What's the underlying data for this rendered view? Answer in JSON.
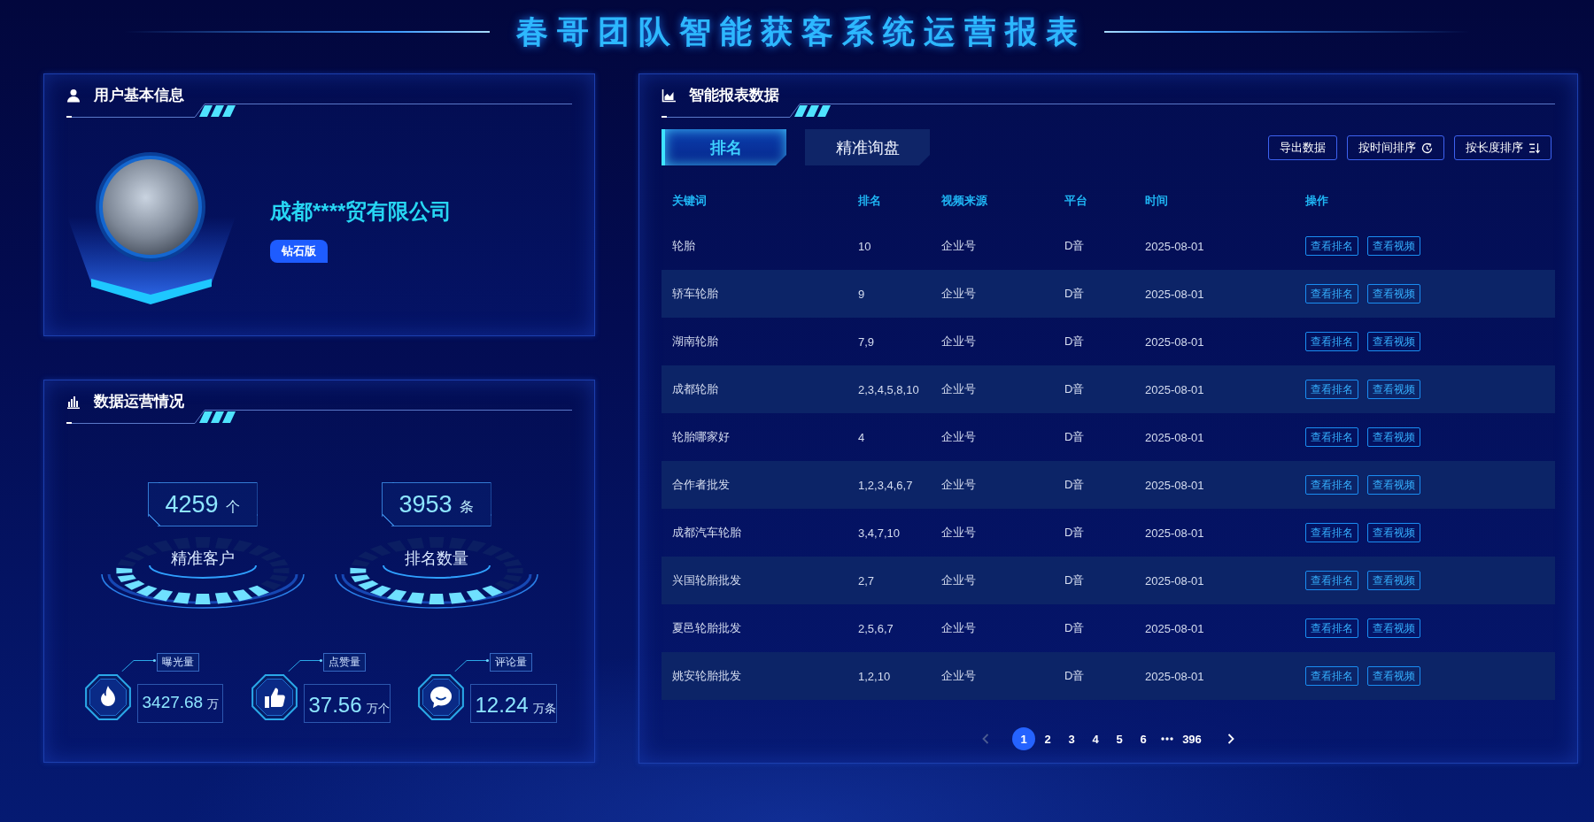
{
  "title": "春哥团队智能获客系统运营报表",
  "user_panel": {
    "title": "用户基本信息",
    "company": "成都****贸有限公司",
    "badge": "钻石版"
  },
  "operations_panel": {
    "title": "数据运营情况",
    "stats": [
      {
        "value": "4259",
        "unit": "个",
        "label": "精准客户"
      },
      {
        "value": "3953",
        "unit": "条",
        "label": "排名数量"
      }
    ],
    "metrics": [
      {
        "kind": "views",
        "label": "曝光量",
        "value": "3427.68",
        "unit": "万"
      },
      {
        "kind": "likes",
        "label": "点赞量",
        "value": "37.56",
        "unit": "万个"
      },
      {
        "kind": "comments",
        "label": "评论量",
        "value": "12.24",
        "unit": "万条"
      }
    ]
  },
  "report_panel": {
    "title": "智能报表数据",
    "tabs": [
      {
        "label": "排名",
        "selected": true
      },
      {
        "label": "精准询盘",
        "selected": false
      }
    ],
    "actions": [
      {
        "kind": "plain",
        "label": "导出数据"
      },
      {
        "kind": "time",
        "label": "按时间排序"
      },
      {
        "kind": "length",
        "label": "按长度排序"
      }
    ],
    "table": {
      "columns": [
        "关键词",
        "排名",
        "视频来源",
        "平台",
        "时间",
        "操作"
      ],
      "rows": [
        {
          "cells": [
            "轮胎",
            "10",
            "企业号",
            "D音",
            "2025-08-01"
          ],
          "actions": [
            "查看排名",
            "查看视频"
          ]
        },
        {
          "cells": [
            "轿车轮胎",
            "9",
            "企业号",
            "D音",
            "2025-08-01"
          ],
          "actions": [
            "查看排名",
            "查看视频"
          ]
        },
        {
          "cells": [
            "湖南轮胎",
            "7,9",
            "企业号",
            "D音",
            "2025-08-01"
          ],
          "actions": [
            "查看排名",
            "查看视频"
          ]
        },
        {
          "cells": [
            "成都轮胎",
            "2,3,4,5,8,10",
            "企业号",
            "D音",
            "2025-08-01"
          ],
          "actions": [
            "查看排名",
            "查看视频"
          ]
        },
        {
          "cells": [
            "轮胎哪家好",
            "4",
            "企业号",
            "D音",
            "2025-08-01"
          ],
          "actions": [
            "查看排名",
            "查看视频"
          ]
        },
        {
          "cells": [
            "合作者批发",
            "1,2,3,4,6,7",
            "企业号",
            "D音",
            "2025-08-01"
          ],
          "actions": [
            "查看排名",
            "查看视频"
          ]
        },
        {
          "cells": [
            "成都汽车轮胎",
            "3,4,7,10",
            "企业号",
            "D音",
            "2025-08-01"
          ],
          "actions": [
            "查看排名",
            "查看视频"
          ]
        },
        {
          "cells": [
            "兴国轮胎批发",
            "2,7",
            "企业号",
            "D音",
            "2025-08-01"
          ],
          "actions": [
            "查看排名",
            "查看视频"
          ]
        },
        {
          "cells": [
            "夏邑轮胎批发",
            "2,5,6,7",
            "企业号",
            "D音",
            "2025-08-01"
          ],
          "actions": [
            "查看排名",
            "查看视频"
          ]
        },
        {
          "cells": [
            "姚安轮胎批发",
            "1,2,10",
            "企业号",
            "D音",
            "2025-08-01"
          ],
          "actions": [
            "查看排名",
            "查看视频"
          ]
        }
      ]
    },
    "pagination": {
      "prev_disabled": true,
      "next_disabled": false,
      "pages": [
        {
          "kind": "page",
          "label": "1",
          "selected": true
        },
        {
          "kind": "page",
          "label": "2",
          "selected": false
        },
        {
          "kind": "page",
          "label": "3",
          "selected": false
        },
        {
          "kind": "page",
          "label": "4",
          "selected": false
        },
        {
          "kind": "page",
          "label": "5",
          "selected": false
        },
        {
          "kind": "page",
          "label": "6",
          "selected": false
        },
        {
          "kind": "more",
          "selected": false
        },
        {
          "kind": "page",
          "label": "396",
          "selected": false
        }
      ]
    }
  }
}
